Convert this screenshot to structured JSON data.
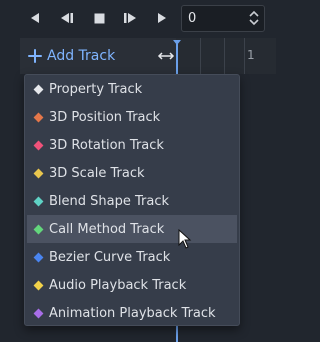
{
  "transport": {
    "buttons": [
      {
        "name": "play-backwards-button",
        "icon": "play-backwards-icon"
      },
      {
        "name": "play-backwards-from-end-button",
        "icon": "play-backwards-from-end-icon"
      },
      {
        "name": "stop-button",
        "icon": "stop-icon"
      },
      {
        "name": "play-from-start-button",
        "icon": "play-from-start-icon"
      },
      {
        "name": "play-button",
        "icon": "play-icon"
      }
    ],
    "time_value": "0"
  },
  "track_header": {
    "add_track_label": "Add Track",
    "ruler_label": "1"
  },
  "menu": {
    "items": [
      {
        "label": "Property Track",
        "color": "#e6e8ec"
      },
      {
        "label": "3D Position Track",
        "color": "#e4774a"
      },
      {
        "label": "3D Rotation Track",
        "color": "#f0527a"
      },
      {
        "label": "3D Scale Track",
        "color": "#e9c64e"
      },
      {
        "label": "Blend Shape Track",
        "color": "#5fd2c5"
      },
      {
        "label": "Call Method Track",
        "color": "#63d67c"
      },
      {
        "label": "Bezier Curve Track",
        "color": "#4a85f0"
      },
      {
        "label": "Audio Playback Track",
        "color": "#f2d24a"
      },
      {
        "label": "Animation Playback Track",
        "color": "#a86ee8"
      }
    ],
    "hovered_index": 5
  },
  "colors": {
    "accent": "#7fb4ff",
    "background": "#21262e",
    "menu_background": "#363d4a",
    "menu_hover": "#4b5261"
  }
}
